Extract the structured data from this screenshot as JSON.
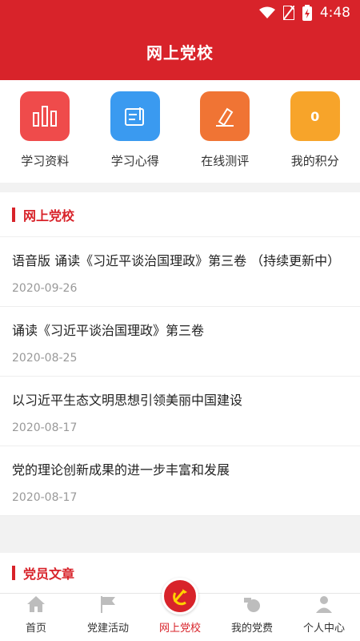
{
  "status": {
    "time": "4:48"
  },
  "header": {
    "title": "网上党校"
  },
  "quick_actions": [
    {
      "label": "学习资料",
      "icon": "bar-chart-icon",
      "color": "#ef4b4b"
    },
    {
      "label": "学习心得",
      "icon": "note-icon",
      "color": "#3a9af0"
    },
    {
      "label": "在线测评",
      "icon": "pen-icon",
      "color": "#f07434"
    },
    {
      "label": "我的积分",
      "icon": "points-badge",
      "color": "#f7a42a",
      "value": "0"
    }
  ],
  "section1": {
    "title": "网上党校",
    "articles": [
      {
        "title": "语音版  诵读《习近平谈治国理政》第三卷  （持续更新中）",
        "date": "2020-09-26"
      },
      {
        "title": "诵读《习近平谈治国理政》第三卷",
        "date": "2020-08-25"
      },
      {
        "title": "以习近平生态文明思想引领美丽中国建设",
        "date": "2020-08-17"
      },
      {
        "title": "党的理论创新成果的进一步丰富和发展",
        "date": "2020-08-17"
      }
    ]
  },
  "section2": {
    "title": "党员文章"
  },
  "tabs": [
    {
      "label": "首页",
      "icon": "home-icon"
    },
    {
      "label": "党建活动",
      "icon": "flag-icon"
    },
    {
      "label": "网上党校",
      "icon": "party-emblem-icon",
      "active": true
    },
    {
      "label": "我的党费",
      "icon": "wallet-icon"
    },
    {
      "label": "个人中心",
      "icon": "user-icon"
    }
  ]
}
